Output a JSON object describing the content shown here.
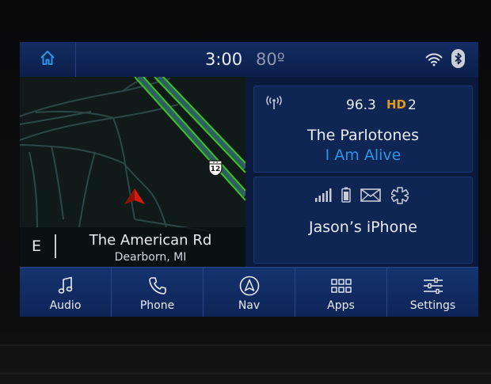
{
  "status_bar": {
    "time": "3:00",
    "temperature": "80º"
  },
  "map": {
    "heading": "E",
    "route_shield": "12",
    "route_shield_prefix": "U S",
    "street_name": "The American Rd",
    "city": "Dearborn, MI"
  },
  "radio": {
    "frequency": "96.3",
    "hd_badge": "HD",
    "hd_channel": "2",
    "artist": "The Parlotones",
    "song": "I Am Alive"
  },
  "phone": {
    "device_name": "Jason’s iPhone"
  },
  "nav": [
    {
      "label": "Audio",
      "icon": "music-note-icon"
    },
    {
      "label": "Phone",
      "icon": "phone-handset-icon"
    },
    {
      "label": "Nav",
      "icon": "navigation-arrow-icon"
    },
    {
      "label": "Apps",
      "icon": "apps-grid-icon"
    },
    {
      "label": "Settings",
      "icon": "sliders-icon"
    }
  ],
  "colors": {
    "accent_blue": "#2f93e8",
    "hd_orange": "#e29a1e",
    "route_green": "#3cc21a",
    "position_marker": "#cc2211"
  }
}
